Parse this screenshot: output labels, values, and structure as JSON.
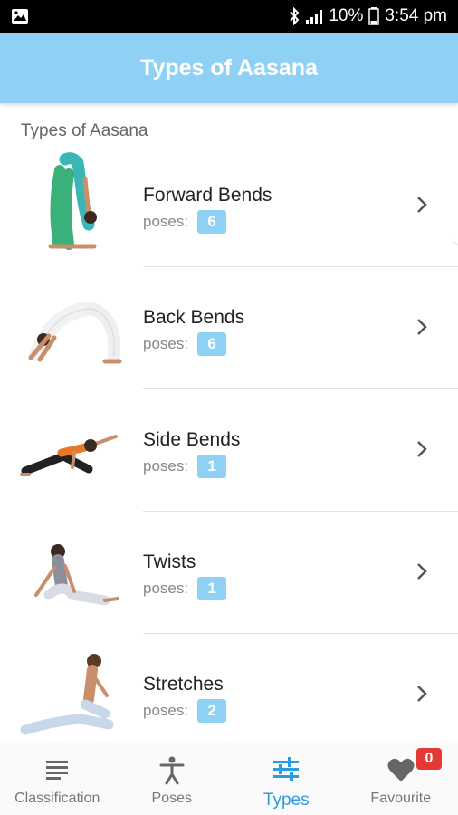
{
  "status_bar": {
    "battery": "10%",
    "time": "3:54 pm"
  },
  "app_bar": {
    "title": "Types of Aasana"
  },
  "section": {
    "title": "Types of Aasana"
  },
  "list": {
    "items": [
      {
        "title": "Forward Bends",
        "poses_label": "poses:",
        "count": "6",
        "icon": "forward-bend-pose-image"
      },
      {
        "title": "Back Bends",
        "poses_label": "poses:",
        "count": "6",
        "icon": "back-bend-pose-image"
      },
      {
        "title": "Side Bends",
        "poses_label": "poses:",
        "count": "1",
        "icon": "side-bend-pose-image"
      },
      {
        "title": "Twists",
        "poses_label": "poses:",
        "count": "1",
        "icon": "twist-pose-image"
      },
      {
        "title": "Stretches",
        "poses_label": "poses:",
        "count": "2",
        "icon": "stretch-pose-image"
      }
    ]
  },
  "bottom_nav": {
    "items": [
      {
        "label": "Classification",
        "icon": "list-icon",
        "active": false
      },
      {
        "label": "Poses",
        "icon": "person-icon",
        "active": false
      },
      {
        "label": "Types",
        "icon": "sliders-icon",
        "active": true
      },
      {
        "label": "Favourite",
        "icon": "heart-icon",
        "active": false
      }
    ],
    "favourite_badge": "0"
  },
  "colors": {
    "accent": "#8fd0f5",
    "active_nav": "#2a9de0",
    "badge_red": "#e53935"
  }
}
